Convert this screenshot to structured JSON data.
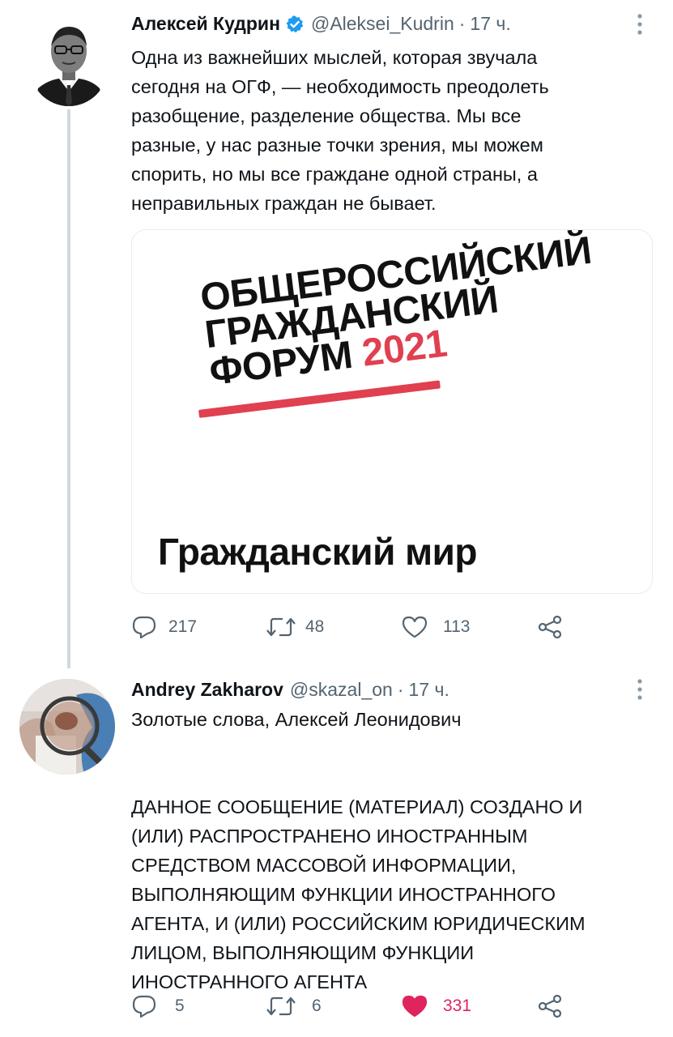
{
  "tweets": [
    {
      "author": "Алексей Кудрин",
      "handle": "@Aleksei_Kudrin",
      "separator": "·",
      "time": "17 ч.",
      "verified": true,
      "text": "Одна из важнейших мыслей, которая звучала\nсегодня на ОГФ, —  необходимость преодолеть\nразобщение, разделение общества. Мы все\nразные, у нас разные точки зрения, мы можем\nспорить, но мы все граждане одной страны, а\nнеправильных граждан не бывает.",
      "media": {
        "title_lines": [
          "ОБЩЕРОССИЙСКИЙ",
          "ГРАЖДАНСКИЙ",
          "ФОРУМ"
        ],
        "year": "2021",
        "caption": "Гражданский мир",
        "accent_color": "#e0404f"
      },
      "actions": {
        "replies": "217",
        "retweets": "48",
        "likes": "113",
        "liked": false
      },
      "icons": [
        "reply-icon",
        "retweet-icon",
        "like-icon",
        "share-icon",
        "more-icon",
        "verified-badge-icon"
      ]
    },
    {
      "author": "Andrey Zakharov",
      "handle": "@skazal_on",
      "separator": "·",
      "time": "17 ч.",
      "verified": false,
      "text": "Золотые слова, Алексей Леонидович\n\n\nДАННОЕ СООБЩЕНИЕ (МАТЕРИАЛ) СОЗДАНО И\n(ИЛИ) РАСПРОСТРАНЕНО ИНОСТРАННЫМ\nСРЕДСТВОМ МАССОВОЙ ИНФОРМАЦИИ,\nВЫПОЛНЯЮЩИМ ФУНКЦИИ ИНОСТРАННОГО\nАГЕНТА, И (ИЛИ) РОССИЙСКИМ ЮРИДИЧЕСКИМ\nЛИЦОМ, ВЫПОЛНЯЮЩИМ ФУНКЦИИ\nИНОСТРАННОГО АГЕНТА",
      "actions": {
        "replies": "5",
        "retweets": "6",
        "likes": "331",
        "liked": true
      }
    }
  ],
  "colors": {
    "text_primary": "#0f1419",
    "text_secondary": "#536471",
    "verified_blue": "#1d9bf0",
    "like_red": "#e0245e",
    "thread_line": "#cfd9de"
  }
}
